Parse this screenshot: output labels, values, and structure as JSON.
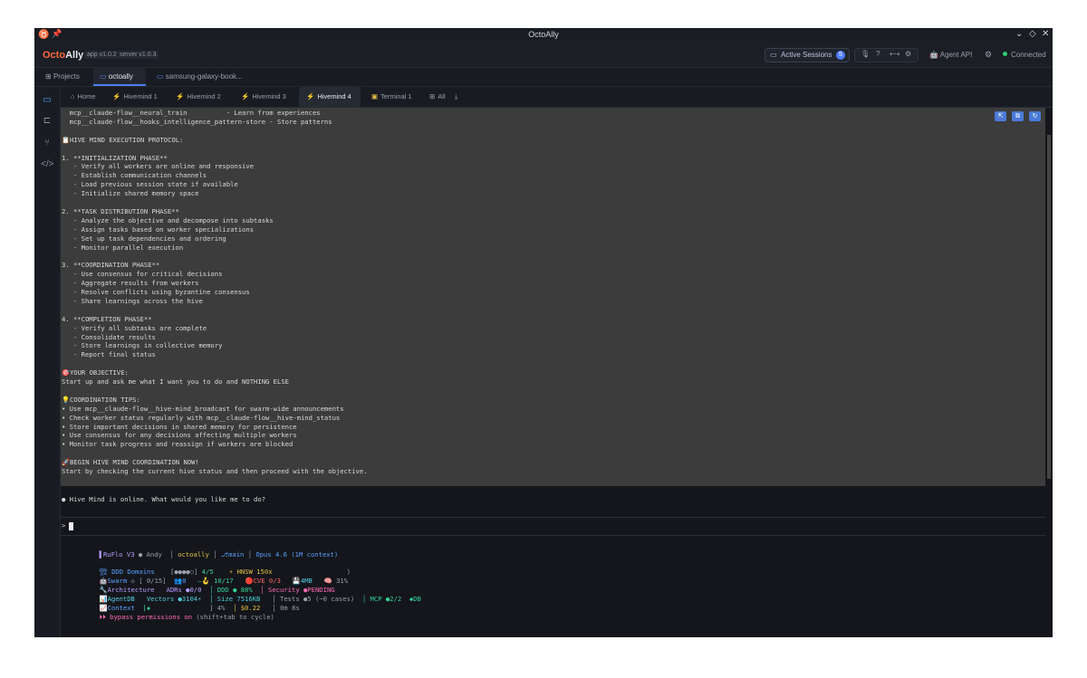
{
  "window": {
    "title": "OctoAlly"
  },
  "header": {
    "brand_part1": "Octo",
    "brand_part2": "Ally",
    "app_version": "app v1.0.2",
    "server_version": "server v1.0.3",
    "active_sessions_label": "Active Sessions",
    "active_sessions_count": "5",
    "agent_api_label": "Agent API",
    "connection_status": "Connected"
  },
  "projects": {
    "projects_label": "Projects",
    "tabs": [
      "octoally",
      "samsung-galaxy-book..."
    ]
  },
  "session_tabs": [
    {
      "label": "Home",
      "icon": "home-icon"
    },
    {
      "label": "Hivemind 1",
      "icon": "hivemind-icon"
    },
    {
      "label": "Hivemind 2",
      "icon": "hivemind-icon"
    },
    {
      "label": "Hivemind 3",
      "icon": "hivemind-icon"
    },
    {
      "label": "Hivemind 4",
      "icon": "hivemind-icon"
    },
    {
      "label": "Terminal 1",
      "icon": "terminal-icon"
    },
    {
      "label": "All",
      "icon": "grid-icon"
    }
  ],
  "terminal": {
    "lines": [
      "  mcp__claude-flow__neural_train          - Learn from experiences",
      "  mcp__claude-flow__hooks_intelligence_pattern-store - Store patterns",
      "",
      "📋HIVE MIND EXECUTION PROTOCOL:",
      "",
      "1. **INITIALIZATION PHASE**",
      "   - Verify all workers are online and responsive",
      "   - Establish communication channels",
      "   - Load previous session state if available",
      "   - Initialize shared memory space",
      "",
      "2. **TASK DISTRIBUTION PHASE**",
      "   - Analyze the objective and decompose into subtasks",
      "   - Assign tasks based on worker specializations",
      "   - Set up task dependencies and ordering",
      "   - Monitor parallel execution",
      "",
      "3. **COORDINATION PHASE**",
      "   - Use consensus for critical decisions",
      "   - Aggregate results from workers",
      "   - Resolve conflicts using byzantine consensus",
      "   - Share learnings across the hive",
      "",
      "4. **COMPLETION PHASE**",
      "   - Verify all subtasks are complete",
      "   - Consolidate results",
      "   - Store learnings in collective memory",
      "   - Report final status",
      "",
      "🎯YOUR OBJECTIVE:",
      "Start up and ask me what I want you to do and NOTHING ELSE",
      "",
      "💡COORDINATION TIPS:",
      "• Use mcp__claude-flow__hive-mind_broadcast for swarm-wide announcements",
      "• Check worker status regularly with mcp__claude-flow__hive-mind_status",
      "• Store important decisions in shared memory for persistence",
      "• Use consensus for any decisions affecting multiple workers",
      "• Monitor task progress and reassign if workers are blocked",
      "",
      "🚀BEGIN HIVE MIND COORDINATION NOW!",
      "Start by checking the current hive status and then proceed with the objective."
    ],
    "response": "● Hive Mind is online. What would you like me to do?",
    "prompt_symbol": ">"
  },
  "statusline": {
    "ruflo": "RuFlo V3",
    "user": "● Andy",
    "project": "octoally",
    "branch": "⎇main",
    "model": "Opus 4.6 (1M context)",
    "row1": {
      "ddd": "🏗 DDD Domains",
      "ddd_bar": "[●●●●○]",
      "ddd_val": "4/5",
      "hnsw": "⚡ HNSW 150x",
      "paren": ")"
    },
    "row2": {
      "swarm": "🤖Swarm",
      "swarm_val": "◇ [ 0/15]",
      "agents": "👥0",
      "hooks": "—🪝 10/17",
      "cve": "🔴CVE 0/3",
      "mem": "💾4MB",
      "ctx": "🧠 31%"
    },
    "row3": {
      "arch": "🔧Architecture",
      "adrs": "ADRs ●0/0",
      "ddd": "│ DDD ● 88%",
      "security": "│ Security ●PENDING"
    },
    "row4": {
      "agentdb": "📊AgentDB",
      "vectors": "Vectors ●3104⚡",
      "size": "│ Size 7516KB",
      "tests": "│ Tests ●5 (~0 cases)",
      "mcp": "│ MCP ●2/2",
      "db": "◆DB"
    },
    "row5": {
      "context": "📈Context",
      "bar": "[▪",
      "pct": "] 4%",
      "cost": "│ $0.22",
      "time": "│ 0m 8s"
    },
    "bypass": "⏵⏵ bypass permissions on",
    "bypass_hint": "(shift+tab to cycle)"
  }
}
